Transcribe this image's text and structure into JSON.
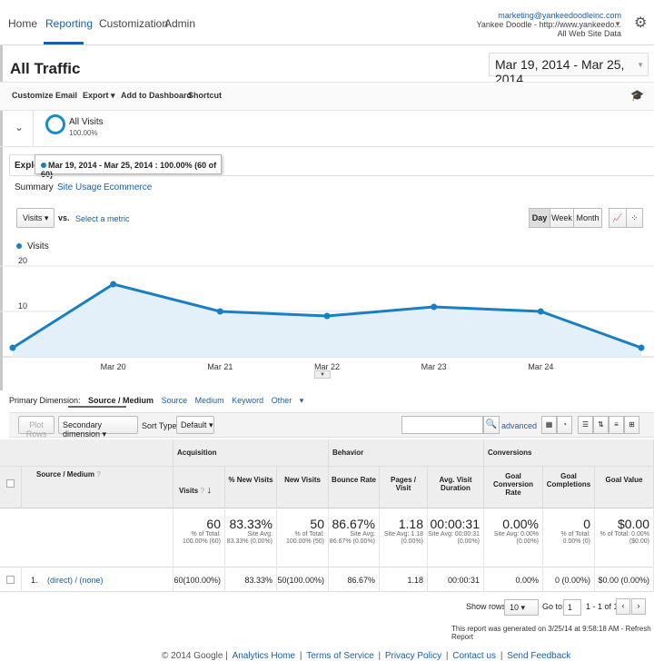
{
  "nav": {
    "tabs": [
      "Home",
      "Reporting",
      "Customization",
      "Admin"
    ],
    "account_email": "marketing@yankeedoodleinc.com",
    "account_property": "Yankee Doodle - http://www.yankeedo...",
    "account_view": "All Web Site Data"
  },
  "page": {
    "title": "All Traffic",
    "date_range": "Mar 19, 2014 - Mar 25, 2014"
  },
  "toolbar": {
    "customize": "Customize",
    "email": "Email",
    "export": "Export",
    "add_to_dashboard": "Add to Dashboard",
    "shortcut": "Shortcut"
  },
  "segment": {
    "name": "All Visits",
    "pct": "100.00%"
  },
  "explorer": {
    "tab_label": "Explorer",
    "tooltip": "Mar 19, 2014 - Mar 25, 2014 : 100.00% (60 of 60)",
    "subtabs": [
      "Summary",
      "Site Usage",
      "Ecommerce"
    ],
    "metric": "Visits",
    "vs": "vs.",
    "select_metric": "Select a metric",
    "granularity": [
      "Day",
      "Week",
      "Month"
    ]
  },
  "chart_data": {
    "type": "area",
    "series": [
      {
        "name": "Visits",
        "values": [
          2,
          16,
          10,
          9,
          11,
          10,
          2
        ]
      }
    ],
    "x": [
      "Mar 19",
      "Mar 20",
      "Mar 21",
      "Mar 22",
      "Mar 23",
      "Mar 24",
      "Mar 25"
    ],
    "x_tick_labels": [
      "Mar 20",
      "Mar 21",
      "Mar 22",
      "Mar 23",
      "Mar 24"
    ],
    "y_ticks": [
      "20",
      "10"
    ],
    "ylim": [
      0,
      20
    ],
    "color": "#1a7fc2",
    "fill": "#e3f0f9"
  },
  "dimensions": {
    "label": "Primary Dimension:",
    "active": "Source / Medium",
    "others": [
      "Source",
      "Medium",
      "Keyword",
      "Other"
    ]
  },
  "controls": {
    "plot_rows": "Plot Rows",
    "secondary_dimension": "Secondary dimension",
    "sort_type_label": "Sort Type:",
    "sort_type": "Default",
    "advanced": "advanced"
  },
  "table": {
    "groups": [
      "Acquisition",
      "Behavior",
      "Conversions"
    ],
    "columns": [
      "Source / Medium",
      "Visits",
      "% New Visits",
      "New Visits",
      "Bounce Rate",
      "Pages / Visit",
      "Avg. Visit Duration",
      "Goal Conversion Rate",
      "Goal Completions",
      "Goal Value"
    ],
    "totals": [
      {
        "big": "60",
        "small": "% of Total: 100.00% (60)"
      },
      {
        "big": "83.33%",
        "small": "Site Avg: 83.33% (0.00%)"
      },
      {
        "big": "50",
        "small": "% of Total: 100.00% (50)"
      },
      {
        "big": "86.67%",
        "small": "Site Avg: 86.67% (0.00%)"
      },
      {
        "big": "1.18",
        "small": "Site Avg: 1.18 (0.00%)"
      },
      {
        "big": "00:00:31",
        "small": "Site Avg: 00:00:31 (0.00%)"
      },
      {
        "big": "0.00%",
        "small": "Site Avg: 0.00% (0.00%)"
      },
      {
        "big": "0",
        "small": "% of Total: 0.00% (0)"
      },
      {
        "big": "$0.00",
        "small": "% of Total: 0.00% ($0.00)"
      }
    ],
    "row": {
      "index": "1.",
      "source": "(direct) / (none)",
      "cells": [
        "60(100.00%)",
        "83.33%",
        "50(100.00%)",
        "86.67%",
        "1.18",
        "00:00:31",
        "0.00%",
        "0 (0.00%)",
        "$0.00 (0.00%)"
      ]
    }
  },
  "pager": {
    "show_rows_label": "Show rows:",
    "rows": "10",
    "goto_label": "Go to:",
    "goto_value": "1",
    "range": "1 - 1 of 1"
  },
  "generated": "This report was generated on 3/25/14 at 9:58:18 AM - Refresh Report",
  "footer": {
    "copyright": "© 2014 Google",
    "links": [
      "Analytics Home",
      "Terms of Service",
      "Privacy Policy",
      "Contact us",
      "Send Feedback"
    ]
  }
}
